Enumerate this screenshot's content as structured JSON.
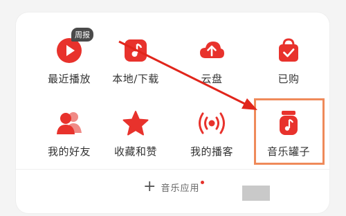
{
  "grid": {
    "items": [
      {
        "id": "recent-play",
        "label": "最近播放",
        "icon": "play-icon",
        "badge": "周报"
      },
      {
        "id": "local-download",
        "label": "本地/下载",
        "icon": "music-file-icon"
      },
      {
        "id": "cloud-disk",
        "label": "云盘",
        "icon": "cloud-upload-icon"
      },
      {
        "id": "purchased",
        "label": "已购",
        "icon": "shopping-bag-icon"
      },
      {
        "id": "my-friends",
        "label": "我的好友",
        "icon": "friends-icon"
      },
      {
        "id": "favorites",
        "label": "收藏和赞",
        "icon": "star-icon"
      },
      {
        "id": "my-podcast",
        "label": "我的播客",
        "icon": "broadcast-icon"
      },
      {
        "id": "music-jar",
        "label": "音乐罐子",
        "icon": "music-jar-icon"
      }
    ]
  },
  "footer": {
    "plus_symbol": "+",
    "add_label": "音乐应用"
  },
  "colors": {
    "accent": "#e8322c",
    "highlight": "#ef8a5a",
    "arrow": "#e1251b"
  }
}
